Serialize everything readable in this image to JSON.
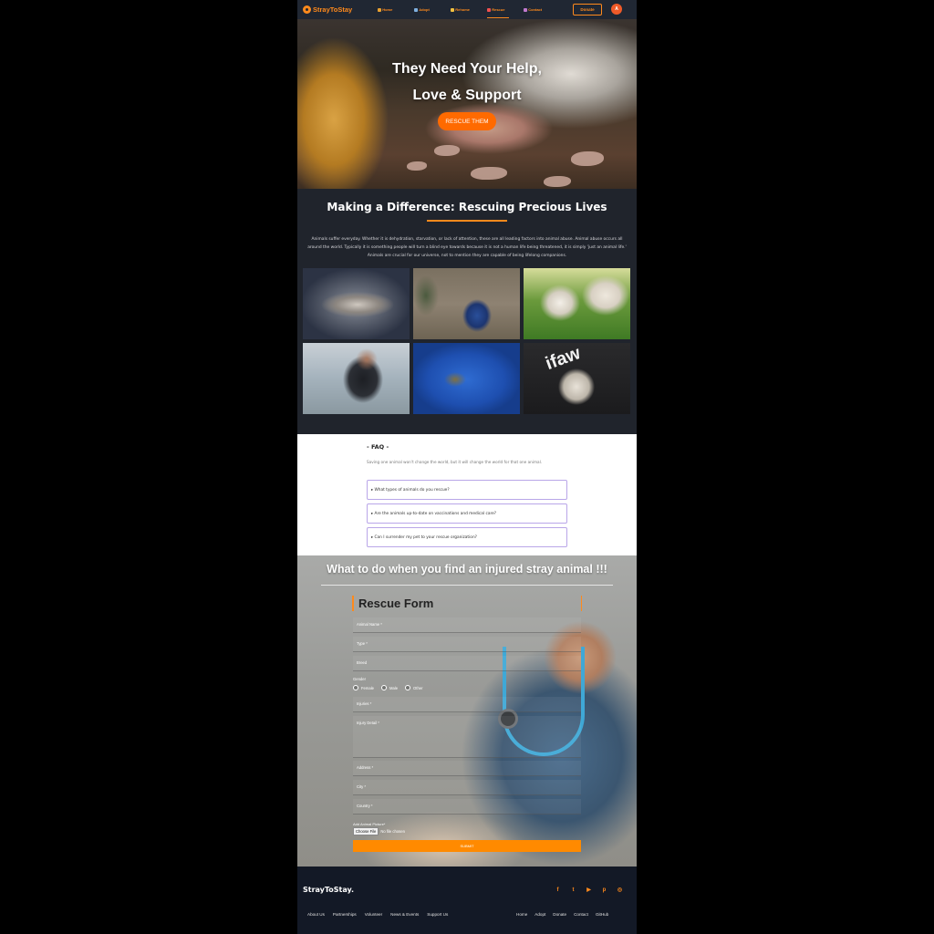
{
  "nav": {
    "brand": "StrayToStay",
    "links": [
      {
        "label": "Home",
        "icon": "home-icon",
        "color": "#e8a030"
      },
      {
        "label": "Adopt",
        "icon": "paw-icon",
        "color": "#7fb0e0"
      },
      {
        "label": "Rehome",
        "icon": "house-icon",
        "color": "#f0c040"
      },
      {
        "label": "Rescue",
        "icon": "rescue-icon",
        "color": "#f05050",
        "active": true
      },
      {
        "label": "Contact",
        "icon": "mail-icon",
        "color": "#c07ad0"
      }
    ],
    "donate": "Donate",
    "avatar": "A",
    "accent": "#ff8a1c"
  },
  "hero": {
    "line1": "They Need Your Help,",
    "line2": "Love & Support",
    "cta": "RESCUE THEM"
  },
  "difference": {
    "title": "Making a Difference: Rescuing Precious Lives",
    "text": "Animals suffer everyday. Whether it is dehydration, starvation, or lack of attention, these are all leading factors into animal abuse. Animal abuse occurs all around the world. Typically it is something people will turn a blind eye towards because it is not a human life being threatened, it is simply 'just an animal life.' Animals are crucial for our universe, not to mention they are capable of being lifelong companions.",
    "photo_text": "ifaw"
  },
  "faq": {
    "title": "- FAQ -",
    "subtitle": "Saving one animal won't change the world, but it will change the world for that one animal.",
    "items": [
      "▸ What types of animals do you rescue?",
      "▸ Are the animals up-to-date on vaccinations and medical care?",
      "▸ Can I surrender my pet to your rescue organization?"
    ]
  },
  "rescue": {
    "title": "What to do when you find an injured stray animal !!!",
    "form_title": "Rescue Form",
    "fields": {
      "animal_name": "Animal Name *",
      "type": "Type *",
      "breed": "Breed",
      "gender_label": "Gender",
      "injuries": "Injuries *",
      "injury_detail": "Injury Detail *",
      "address": "Address *",
      "city": "City *",
      "country": "Country *"
    },
    "gender_options": [
      "Female",
      "Male",
      "Other"
    ],
    "picture_label": "Add Animal Picture*",
    "file_button": "Choose File",
    "file_status": "No file chosen",
    "submit": "SUBMIT"
  },
  "footer": {
    "brand": "StrayToStay.",
    "social": [
      "facebook-icon",
      "twitter-icon",
      "youtube-icon",
      "pinterest-icon",
      "instagram-icon"
    ],
    "left_links": [
      "About Us",
      "Partnerships",
      "Volunteer",
      "News & Events",
      "Support Us"
    ],
    "right_links": [
      "Home",
      "Adopt",
      "Donate",
      "Contact",
      "GitHub"
    ]
  }
}
